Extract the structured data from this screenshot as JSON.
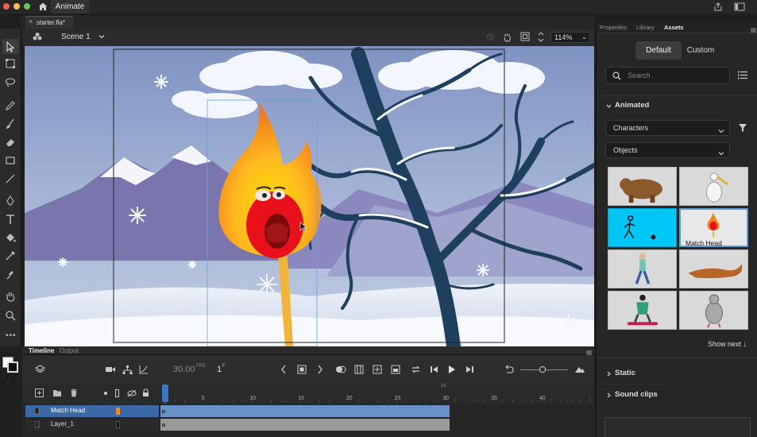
{
  "app": {
    "name": "Animate"
  },
  "document": {
    "tab_title": "starter.fla*"
  },
  "scene": {
    "name": "Scene 1",
    "zoom": "114%"
  },
  "timeline": {
    "tabs": [
      "Timeline",
      "Output"
    ],
    "fps": "30.00",
    "fps_unit": "FPS",
    "current_frame": "1",
    "frame_unit": "F",
    "ruler_ticks": [
      "5",
      "10",
      "15",
      "20",
      "25",
      "30",
      "35",
      "40"
    ],
    "seconds_marker": "1s",
    "layers": [
      {
        "name": "Match Head",
        "selected": true,
        "color": "#f08a24"
      },
      {
        "name": "Layer_1",
        "selected": false,
        "color": "#1a1a1a"
      }
    ]
  },
  "panel": {
    "tabs": [
      "Properties",
      "Library",
      "Assets"
    ],
    "active_tab": "Assets",
    "modes": [
      "Default",
      "Custom"
    ],
    "active_mode": "Default",
    "search_placeholder": "Search",
    "animated_section": "Animated",
    "category_select": "Characters",
    "type_select": "Objects",
    "assets": [
      {
        "name": "Bear",
        "label": ""
      },
      {
        "name": "Pelican",
        "label": ""
      },
      {
        "name": "Stick figure",
        "label": ""
      },
      {
        "name": "Match Head",
        "label": "Match Head"
      },
      {
        "name": "Walker",
        "label": ""
      },
      {
        "name": "Squirrel",
        "label": ""
      },
      {
        "name": "Snowboarder",
        "label": ""
      },
      {
        "name": "Pigeon",
        "label": ""
      }
    ],
    "show_next": "Show next",
    "static_section": "Static",
    "sound_section": "Sound clips"
  },
  "colors": {
    "accent": "#3d76c2",
    "stage_sky": "#a9b8d6",
    "flame": "#f58220",
    "selected_asset": "#00c6f5"
  }
}
